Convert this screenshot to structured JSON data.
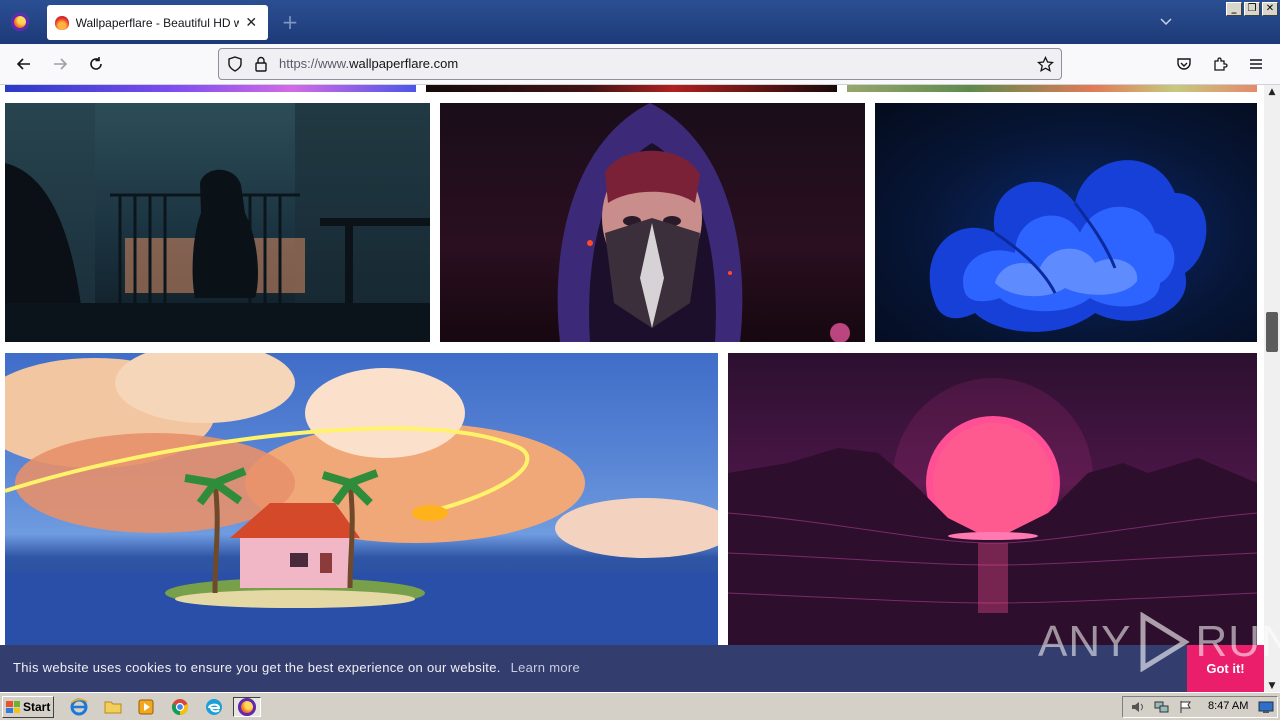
{
  "browser": {
    "tab_title": "Wallpaperflare - Beautiful HD wallpapers",
    "tab_close": "✕",
    "new_tab": "+",
    "url_prefix": "https://www.",
    "url_domain": "wallpaperflare.com"
  },
  "page": {
    "images": [
      {
        "name": "top-strip-1"
      },
      {
        "name": "top-strip-2"
      },
      {
        "name": "top-strip-3"
      },
      {
        "name": "anime-girl-balcony"
      },
      {
        "name": "hooded-masked-woman"
      },
      {
        "name": "blue-bloom-abstract"
      },
      {
        "name": "island-house-anime"
      },
      {
        "name": "synthwave-sunset"
      }
    ]
  },
  "cookie_banner": {
    "message": "This website uses cookies to ensure you get the best experience on our website.",
    "learn_more": "Learn more",
    "accept": "Got it!"
  },
  "watermark": {
    "text_left": "ANY",
    "text_right": "RUN"
  },
  "taskbar": {
    "start_label": "Start",
    "clock": "8:47 AM"
  },
  "icons": [
    "firefox-icon",
    "back-icon",
    "forward-icon",
    "reload-icon",
    "shield-icon",
    "lock-icon",
    "star-icon",
    "pocket-icon",
    "extensions-icon",
    "menu-icon",
    "ie-icon",
    "folder-icon",
    "media-icon",
    "chrome-icon",
    "edge-icon",
    "volume-icon",
    "network-icon",
    "flag-icon",
    "show-desktop-icon"
  ]
}
